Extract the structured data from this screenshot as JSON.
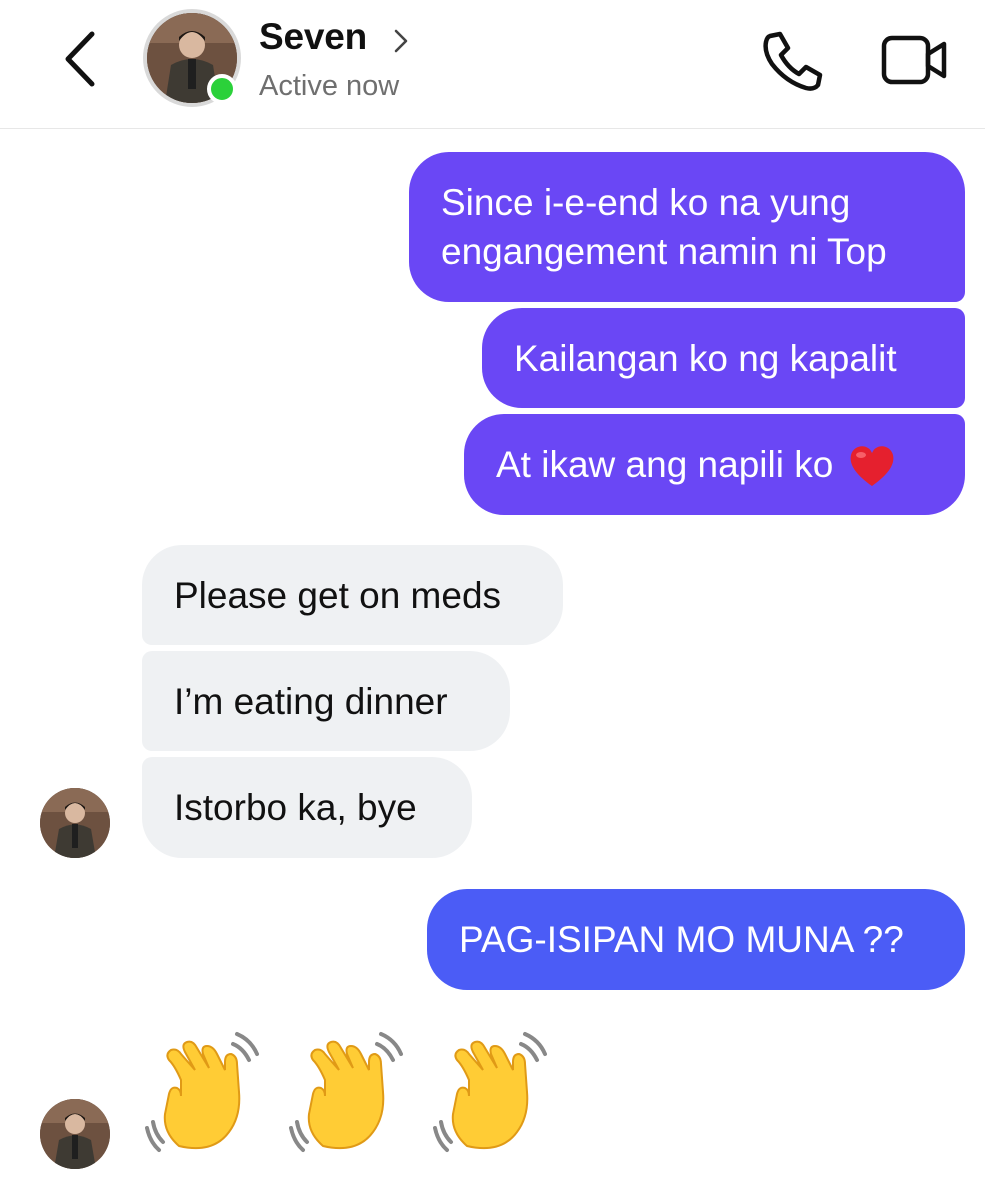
{
  "header": {
    "contact_name": "Seven",
    "status": "Active now",
    "icons": {
      "back": "chevron-left-icon",
      "call": "phone-icon",
      "video": "video-camera-icon",
      "name_chevron": "chevron-right-icon"
    },
    "online_color": "#2bd13a"
  },
  "messages": [
    {
      "direction": "outgoing",
      "text": "Since i-e-end ko na yung engangement namin ni Top",
      "color": "#6a47f5"
    },
    {
      "direction": "outgoing",
      "text": "Kailangan ko ng kapalit",
      "color": "#6a47f5"
    },
    {
      "direction": "outgoing",
      "text": "At ikaw ang napili ko",
      "emoji": "red-heart-icon",
      "color": "#6a47f5"
    },
    {
      "direction": "incoming",
      "text": "Please get on meds",
      "color": "#eff1f3"
    },
    {
      "direction": "incoming",
      "text": "I’m eating dinner",
      "color": "#eff1f3"
    },
    {
      "direction": "incoming",
      "text": "Istorbo ka, bye",
      "color": "#eff1f3"
    },
    {
      "direction": "outgoing",
      "text": "PAG-ISIPAN MO MUNA ??",
      "color": "#4b5cf6"
    },
    {
      "direction": "incoming",
      "emoji_only": [
        "waving-hand-icon",
        "waving-hand-icon",
        "waving-hand-icon"
      ]
    }
  ]
}
